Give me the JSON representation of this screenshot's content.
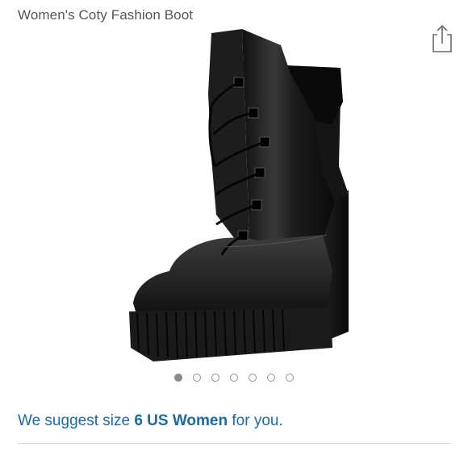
{
  "header": {
    "product_title": "Women's Coty Fashion Boot",
    "share_icon": "share-icon"
  },
  "gallery": {
    "image_subject": "boot-product-image",
    "dot_count": 7,
    "active_index": 0
  },
  "size_suggestion": {
    "prefix": "We suggest size ",
    "size": "6 US Women",
    "suffix": " for you."
  },
  "colors": {
    "link_blue": "#1a6aa6",
    "title_gray": "#555555",
    "dot_active": "#8a8a8a"
  }
}
